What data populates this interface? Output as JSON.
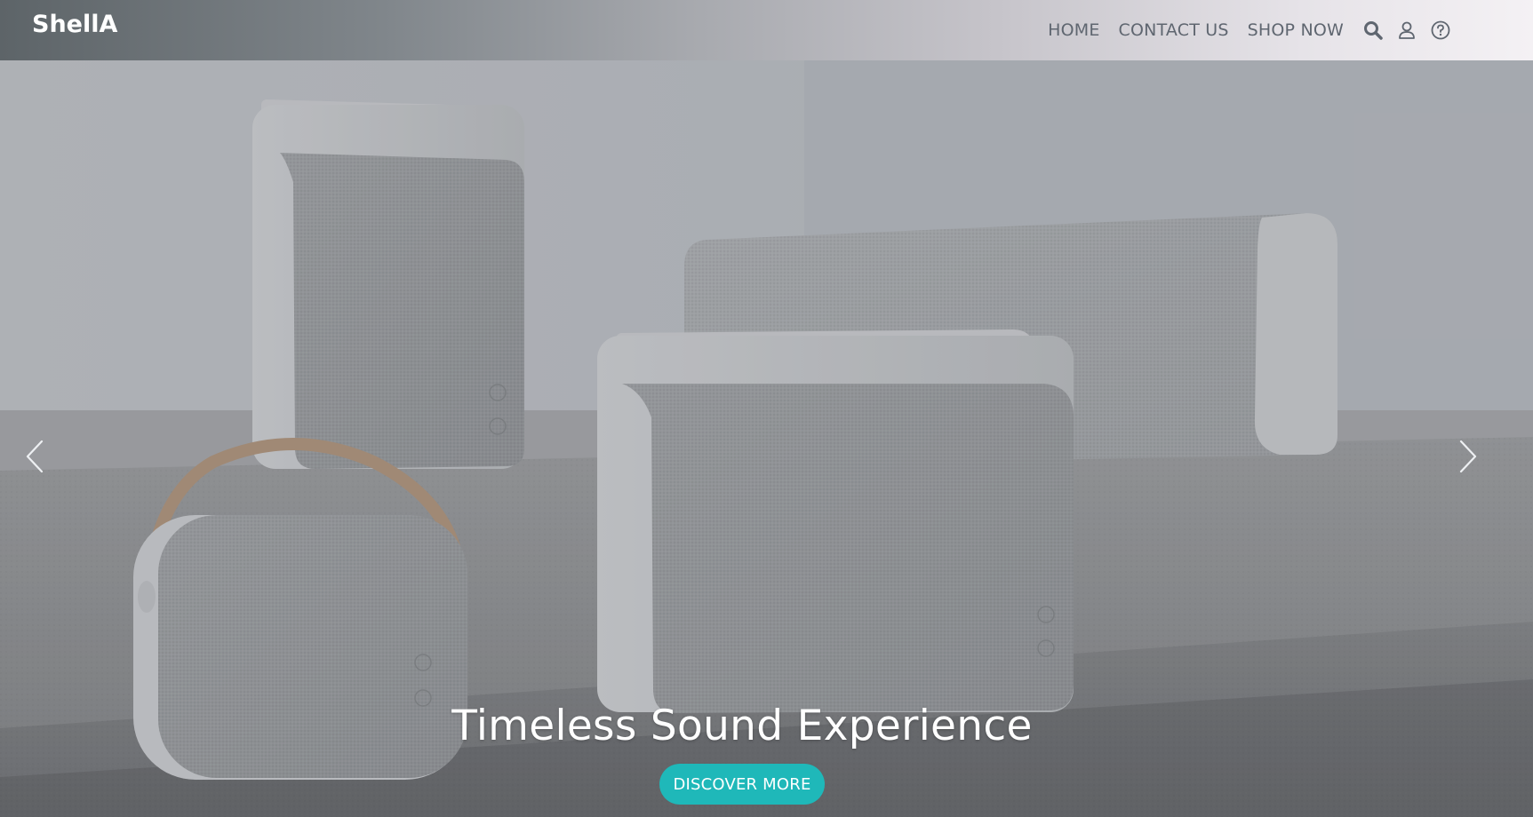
{
  "brand": {
    "name": "ShellA"
  },
  "nav": {
    "items": [
      {
        "label": "HOME"
      },
      {
        "label": "CONTACT US"
      },
      {
        "label": "SHOP NOW"
      }
    ],
    "icons": [
      "search-icon",
      "user-icon",
      "help-icon"
    ]
  },
  "hero": {
    "title": "Timeless Sound Experience",
    "cta_label": "DISCOVER MORE",
    "controls": [
      "chevron-left-icon",
      "chevron-right-icon"
    ]
  },
  "colors": {
    "accent": "#1fb8b9",
    "nav_text": "#5f6670",
    "brand_text": "#ffffff"
  }
}
